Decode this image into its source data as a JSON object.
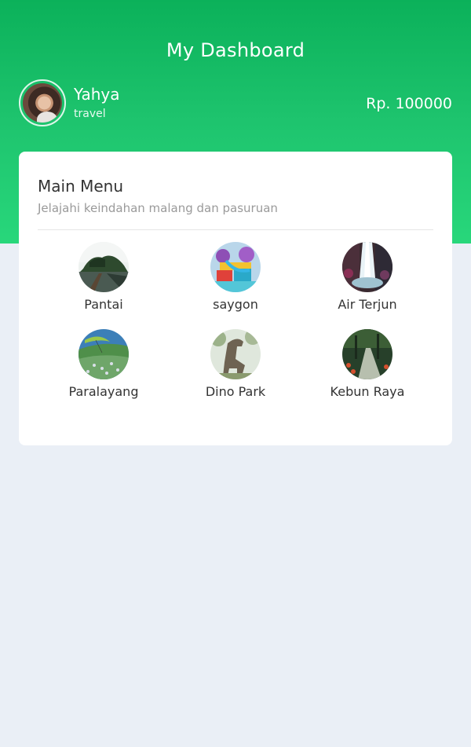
{
  "header": {
    "title": "My Dashboard",
    "user": {
      "name": "Yahya",
      "role": "travel",
      "avatar_icon": "user-avatar-photo"
    },
    "balance": "Rp. 100000"
  },
  "menu": {
    "title": "Main Menu",
    "subtitle": "Jelajahi keindahan malang dan pasuruan",
    "items": [
      {
        "label": "Pantai",
        "icon": "beach-photo"
      },
      {
        "label": "saygon",
        "icon": "waterpark-photo"
      },
      {
        "label": "Air Terjun",
        "icon": "waterfall-photo"
      },
      {
        "label": "Paralayang",
        "icon": "paragliding-photo"
      },
      {
        "label": "Dino Park",
        "icon": "dinosaur-photo"
      },
      {
        "label": "Kebun Raya",
        "icon": "garden-photo"
      }
    ]
  },
  "colors": {
    "header_green": "#1ec46e",
    "background": "#eaeff6",
    "card": "#ffffff"
  }
}
